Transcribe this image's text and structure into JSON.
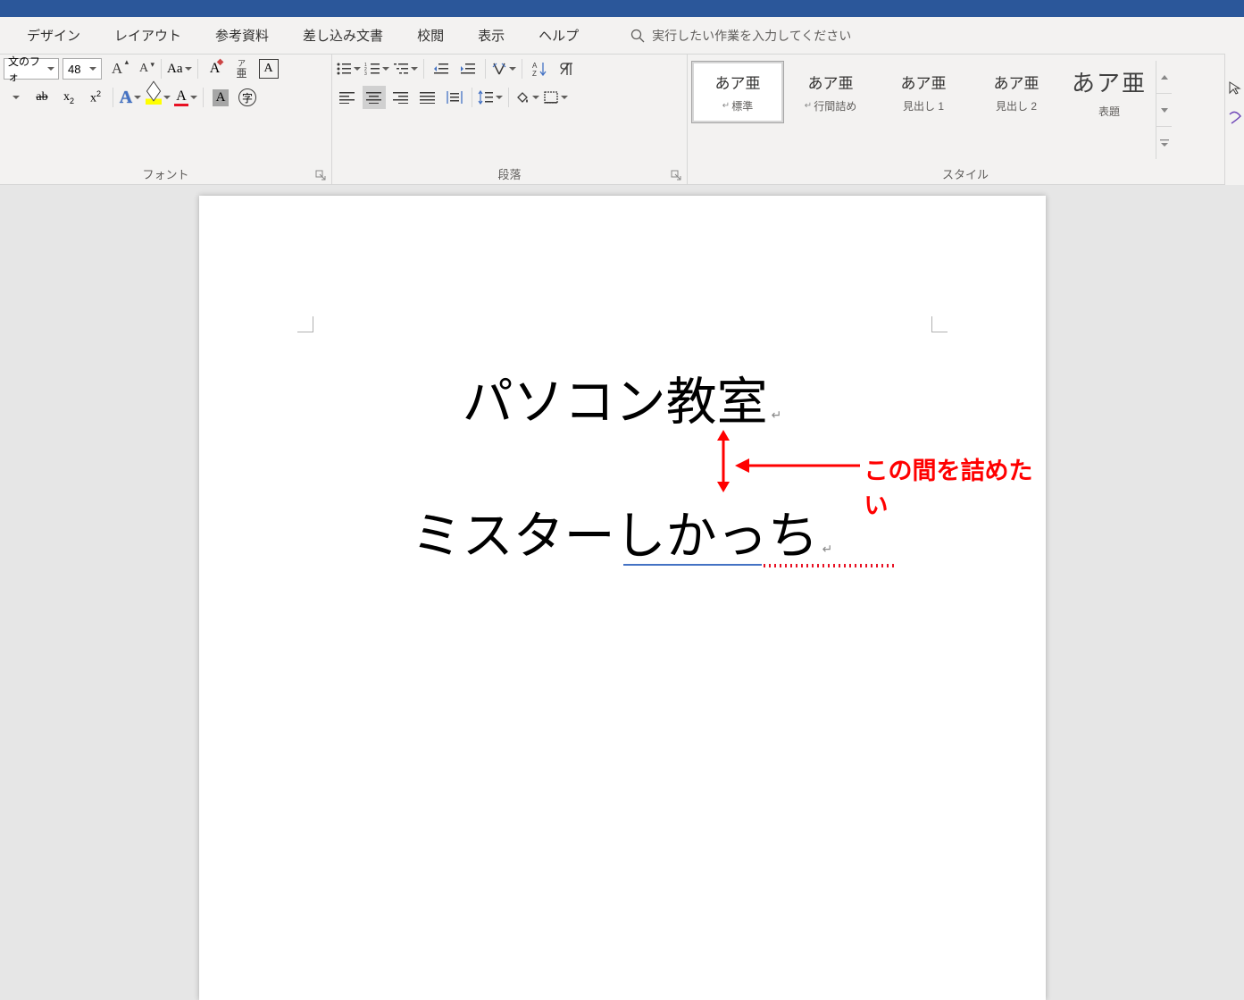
{
  "tabs": [
    "デザイン",
    "レイアウト",
    "参考資料",
    "差し込み文書",
    "校閲",
    "表示",
    "ヘルプ"
  ],
  "tellme": "実行したい作業を入力してください",
  "font": {
    "name": "文のフォ",
    "size": "48"
  },
  "groups": {
    "font": "フォント",
    "paragraph": "段落",
    "styles": "スタイル"
  },
  "style_preview": "あア亜",
  "styles": [
    {
      "name": "標準",
      "para": true
    },
    {
      "name": "行間詰め",
      "para": true
    },
    {
      "name": "見出し 1",
      "para": false
    },
    {
      "name": "見出し 2",
      "para": false
    },
    {
      "name": "表題",
      "para": false,
      "title": true
    }
  ],
  "doc": {
    "line1": "パソコン教室",
    "line2": "ミスターしかっち"
  },
  "annotation": "この間を詰めたい"
}
